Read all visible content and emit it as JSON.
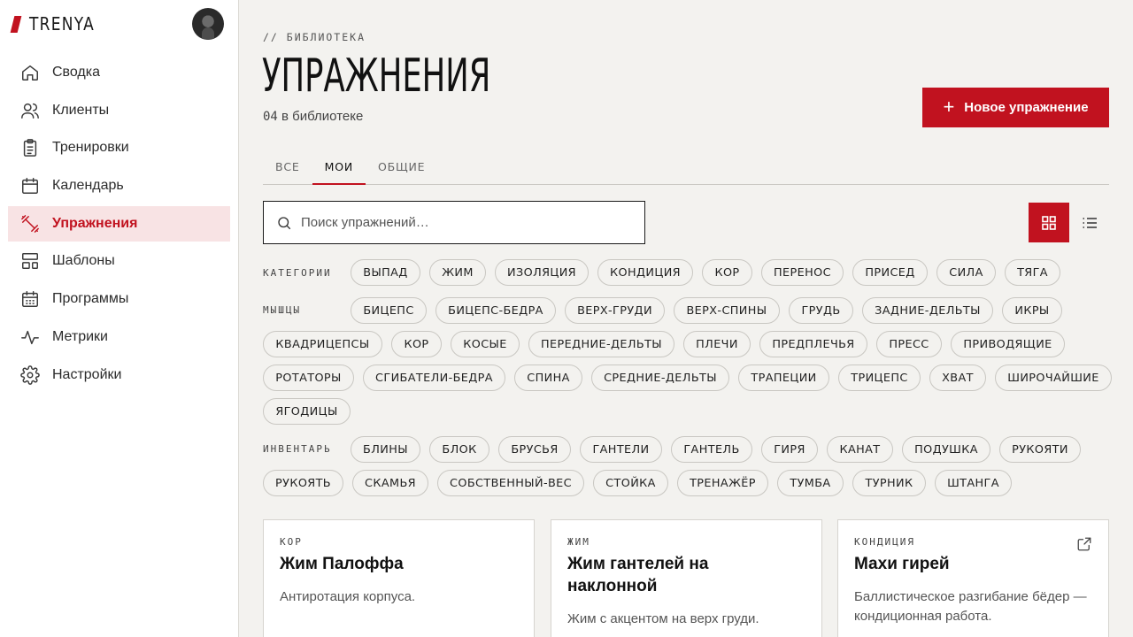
{
  "brand": {
    "name": "TRENYA"
  },
  "sidebar": {
    "items": [
      {
        "label": "Сводка",
        "icon": "home-icon"
      },
      {
        "label": "Клиенты",
        "icon": "users-icon"
      },
      {
        "label": "Тренировки",
        "icon": "clipboard-icon"
      },
      {
        "label": "Календарь",
        "icon": "calendar-icon"
      },
      {
        "label": "Упражнения",
        "icon": "dumbbell-icon",
        "active": true
      },
      {
        "label": "Шаблоны",
        "icon": "layout-icon"
      },
      {
        "label": "Программы",
        "icon": "calendar-grid-icon"
      },
      {
        "label": "Метрики",
        "icon": "activity-icon"
      },
      {
        "label": "Настройки",
        "icon": "gear-icon"
      }
    ]
  },
  "header": {
    "breadcrumb": "// БИБЛИОТЕКА",
    "title": "УПРАЖНЕНИЯ",
    "count_num": "04",
    "count_text": " в библиотеке",
    "new_button": "Новое упражнение"
  },
  "tabs": [
    {
      "label": "ВСЕ"
    },
    {
      "label": "МОИ",
      "active": true
    },
    {
      "label": "ОБЩИЕ"
    }
  ],
  "search": {
    "placeholder": "Поиск упражнений…"
  },
  "filters": {
    "categories_label": "КАТЕГОРИИ",
    "categories": [
      "ВЫПАД",
      "ЖИМ",
      "ИЗОЛЯЦИЯ",
      "КОНДИЦИЯ",
      "КОР",
      "ПЕРЕНОС",
      "ПРИСЕД",
      "СИЛА",
      "ТЯГА"
    ],
    "muscles_label": "МЫШЦЫ",
    "muscles": [
      "БИЦЕПС",
      "БИЦЕПС-БЕДРА",
      "ВЕРХ-ГРУДИ",
      "ВЕРХ-СПИНЫ",
      "ГРУДЬ",
      "ЗАДНИЕ-ДЕЛЬТЫ",
      "ИКРЫ",
      "КВАДРИЦЕПСЫ",
      "КОР",
      "КОСЫЕ",
      "ПЕРЕДНИЕ-ДЕЛЬТЫ",
      "ПЛЕЧИ",
      "ПРЕДПЛЕЧЬЯ",
      "ПРЕСС",
      "ПРИВОДЯЩИЕ",
      "РОТАТОРЫ",
      "СГИБАТЕЛИ-БЕДРА",
      "СПИНА",
      "СРЕДНИЕ-ДЕЛЬТЫ",
      "ТРАПЕЦИИ",
      "ТРИЦЕПС",
      "ХВАТ",
      "ШИРОЧАЙШИЕ",
      "ЯГОДИЦЫ"
    ],
    "equipment_label": "ИНВЕНТАРЬ",
    "equipment": [
      "БЛИНЫ",
      "БЛОК",
      "БРУСЬЯ",
      "ГАНТЕЛИ",
      "ГАНТЕЛЬ",
      "ГИРЯ",
      "КАНАТ",
      "ПОДУШКА",
      "РУКОЯТИ",
      "РУКОЯТЬ",
      "СКАМЬЯ",
      "СОБСТВЕННЫЙ-ВЕС",
      "СТОЙКА",
      "ТРЕНАЖЁР",
      "ТУМБА",
      "ТУРНИК",
      "ШТАНГА"
    ]
  },
  "cards": [
    {
      "category": "КОР",
      "title": "Жим Палоффа",
      "description": "Антиротация корпуса."
    },
    {
      "category": "ЖИМ",
      "title": "Жим гантелей на наклонной",
      "description": "Жим с акцентом на верх груди."
    },
    {
      "category": "КОНДИЦИЯ",
      "title": "Махи гирей",
      "description": "Баллистическое разгибание бёдер — кондиционная работа.",
      "external": true
    }
  ],
  "colors": {
    "accent": "#c1121f",
    "accent_soft": "#f8e3e4",
    "background": "#f3f2ef"
  }
}
